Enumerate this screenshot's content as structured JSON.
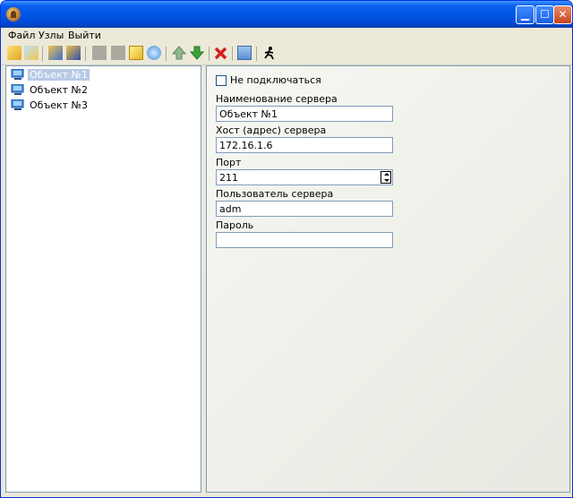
{
  "menu": {
    "file": "Файл",
    "nodes": "Узлы",
    "exit": "Выйти"
  },
  "toolbar": {
    "icons": [
      "add-node-icon",
      "open-folder-icon",
      "copy-node-icon",
      "paste-node-icon",
      "disabled-icon-1",
      "disabled-icon-2",
      "new-item-icon",
      "refresh-icon",
      "move-up-icon",
      "move-down-icon",
      "delete-icon",
      "save-icon",
      "run-icon"
    ]
  },
  "tree": {
    "items": [
      {
        "label": "Объект №1",
        "selected": true
      },
      {
        "label": "Объект №2",
        "selected": false
      },
      {
        "label": "Объект №3",
        "selected": false
      }
    ]
  },
  "form": {
    "no_connect_label": "Не подключаться",
    "no_connect_checked": false,
    "server_name_label": "Наименование сервера",
    "server_name_value": "Объект №1",
    "host_label": "Хост (адрес) сервера",
    "host_value": "172.16.1.6",
    "port_label": "Порт",
    "port_value": "211",
    "user_label": "Пользователь сервера",
    "user_value": "adm",
    "password_label": "Пароль",
    "password_value": ""
  },
  "colors": {
    "titlebar": "#0054e3",
    "accent": "#ece9d8",
    "delete": "#d62020",
    "arrow_green": "#3aa33a"
  }
}
